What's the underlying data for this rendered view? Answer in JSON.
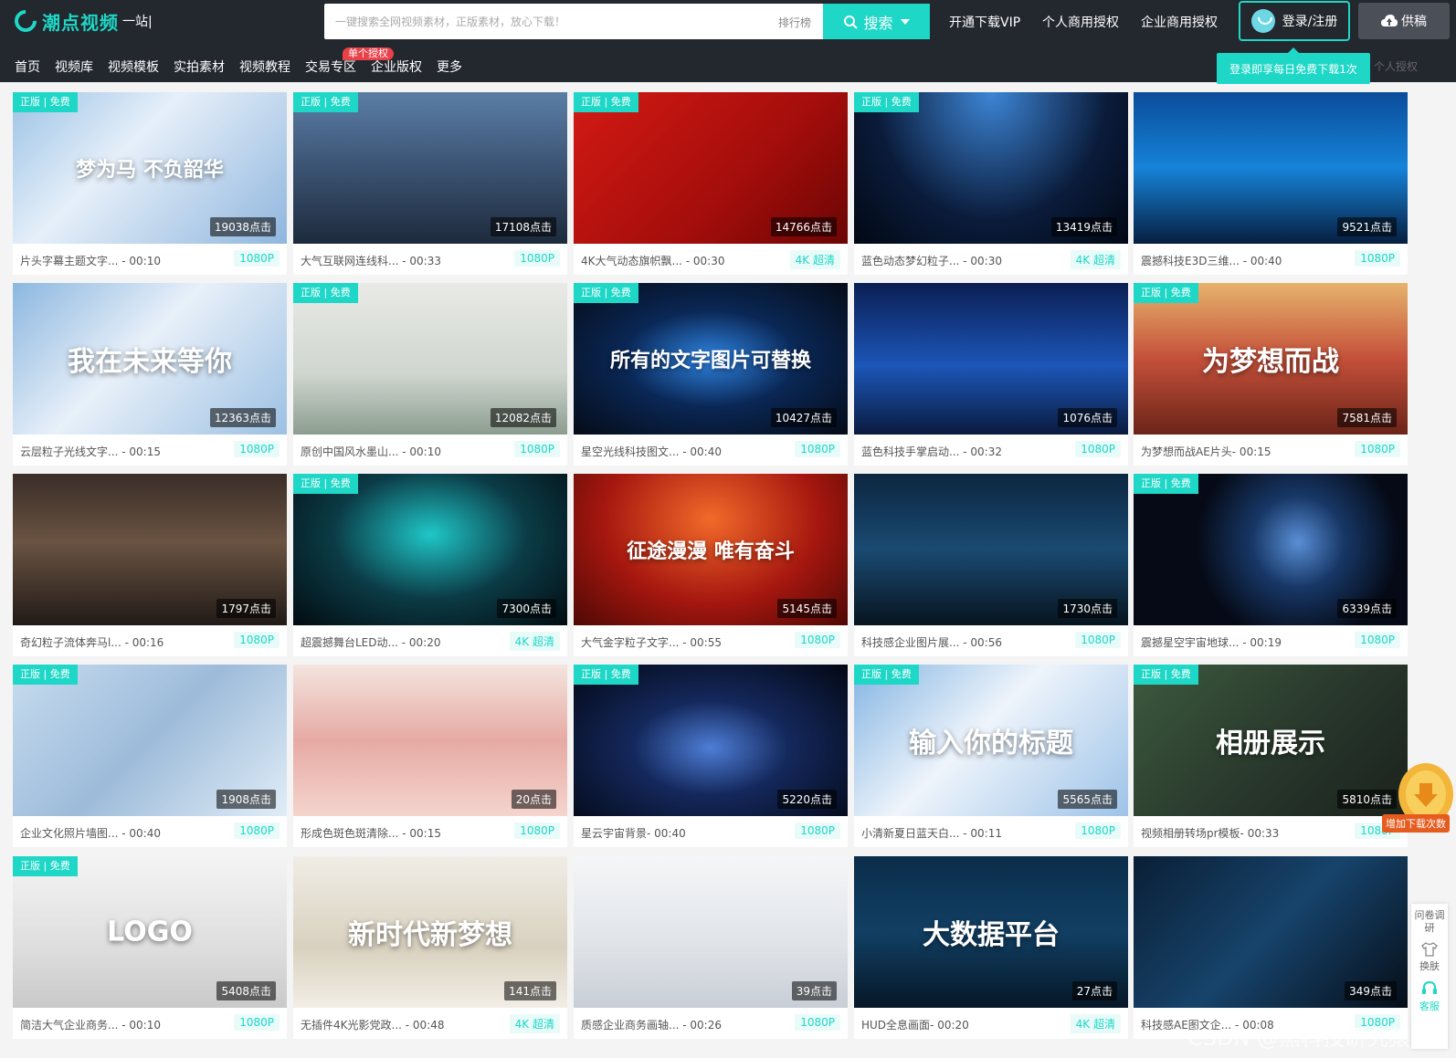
{
  "header": {
    "logo_text": "潮点视频",
    "logo_tag": "一站|",
    "search_placeholder": "一键搜索全网视频素材，正版素材，放心下载！",
    "rank_label": "排行榜",
    "search_button": "搜索",
    "links": [
      "开通下载VIP",
      "个人商用授权",
      "企业商用授权"
    ],
    "login": "登录/注册",
    "contribute": "供稿",
    "tip": "登录即享每日免费下载1次",
    "personal": "个人授权"
  },
  "nav": {
    "items": [
      "首页",
      "视频库",
      "视频模板",
      "实拍素材",
      "视频教程",
      "交易专区",
      "企业版权",
      "更多"
    ],
    "badge": "单个授权"
  },
  "badge_text": "正版 | 免费",
  "cards": [
    {
      "title": "片头字幕主题文字... - 00:10",
      "hits": "19038点击",
      "res": "1080P",
      "badge": true,
      "overlay": "梦为马 不负韶华",
      "bg": "linear-gradient(135deg,#9cc3e6,#e6eff9 40%,#8fb6de)"
    },
    {
      "title": "大气互联网连线科... - 00:33",
      "hits": "17108点击",
      "res": "1080P",
      "badge": true,
      "overlay": "",
      "bg": "linear-gradient(180deg,#5b7ea5,#3b5373 50%,#1d2a3c)"
    },
    {
      "title": "4K大气动态旗帜飘... - 00:30",
      "hits": "14766点击",
      "res": "4K 超清",
      "badge": true,
      "overlay": "",
      "bg": "linear-gradient(135deg,#d41a14,#a30d0b 60%,#6b0605)"
    },
    {
      "title": "蓝色动态梦幻粒子... - 00:30",
      "hits": "13419点击",
      "res": "4K 超清",
      "badge": true,
      "overlay": "",
      "bg": "radial-gradient(ellipse at 50% 0%,#3d86d6,#0a1b3a 60%,#020814)"
    },
    {
      "title": "震撼科技E3D三维... - 00:40",
      "hits": "9521点击",
      "res": "1080P",
      "badge": false,
      "overlay": "",
      "bg": "linear-gradient(180deg,#0a4c9a,#1683d8 50%,#061e3f)"
    },
    {
      "title": "云层粒子光线文字... - 00:15",
      "hits": "12363点击",
      "res": "1080P",
      "badge": false,
      "overlay": "我在未来等你",
      "bg": "linear-gradient(135deg,#8cb7e0,#e8f0f9 45%,#9cc0e3)"
    },
    {
      "title": "原创中国风水墨山... - 00:10",
      "hits": "12082点击",
      "res": "1080P",
      "badge": true,
      "overlay": "",
      "bg": "linear-gradient(180deg,#e9eae5,#cfd6cf 60%,#8c9d8f)"
    },
    {
      "title": "星空光线科技图文... - 00:40",
      "hits": "10427点击",
      "res": "1080P",
      "badge": true,
      "overlay": "所有的文字图片可替换",
      "bg": "radial-gradient(ellipse at 50% 50%,#2f85e3,#0a2755 45%,#050b17)"
    },
    {
      "title": "蓝色科技手掌启动... - 00:32",
      "hits": "1076点击",
      "res": "1080P",
      "badge": false,
      "overlay": "",
      "bg": "linear-gradient(180deg,#0b1f54,#1c56b8 55%,#0a1a3e)"
    },
    {
      "title": "为梦想而战AE片头- 00:15",
      "hits": "7581点击",
      "res": "1080P",
      "badge": true,
      "overlay": "为梦想而战",
      "bg": "linear-gradient(180deg,#e7b36c,#c4503a 50%,#6b2418)"
    },
    {
      "title": "奇幻粒子流体奔马l... - 00:16",
      "hits": "1797点击",
      "res": "1080P",
      "badge": false,
      "overlay": "",
      "bg": "linear-gradient(180deg,#3a2d28,#6a5342 45%,#211a17)"
    },
    {
      "title": "超震撼舞台LED动... - 00:20",
      "hits": "7300点击",
      "res": "4K 超清",
      "badge": true,
      "overlay": "",
      "bg": "radial-gradient(ellipse at 50% 40%,#1fc7c8,#0b3b46 50%,#020b10)"
    },
    {
      "title": "大气金字粒子文字... - 00:55",
      "hits": "5145点击",
      "res": "1080P",
      "badge": false,
      "overlay": "征途漫漫 唯有奋斗",
      "bg": "radial-gradient(ellipse at 50% 30%,#f26a2a,#a6170f 55%,#4e0805)"
    },
    {
      "title": "科技感企业图片展... - 00:56",
      "hits": "1730点击",
      "res": "1080P",
      "badge": false,
      "overlay": "",
      "bg": "linear-gradient(180deg,#0c2640,#1a4a72 50%,#07141f)"
    },
    {
      "title": "震撼星空宇宙地球... - 00:19",
      "hits": "6339点击",
      "res": "1080P",
      "badge": true,
      "overlay": "",
      "bg": "radial-gradient(circle at 60% 45%,#5a8fd6,#173766 25%,#050a16 55%)"
    },
    {
      "title": "企业文化照片墙图... - 00:40",
      "hits": "1908点击",
      "res": "1080P",
      "badge": true,
      "overlay": "",
      "bg": "linear-gradient(135deg,#c7dcef,#9dbbda 50%,#e0edf7)"
    },
    {
      "title": "形成色斑色斑清除... - 00:15",
      "hits": "20点击",
      "res": "1080P",
      "badge": false,
      "overlay": "",
      "bg": "linear-gradient(180deg,#f4e4df,#e6aaa3 50%,#f5d4ce)"
    },
    {
      "title": "星云宇宙背景- 00:40",
      "hits": "5220点击",
      "res": "1080P",
      "badge": true,
      "overlay": "",
      "bg": "radial-gradient(ellipse at 50% 55%,#4e7ed6,#14285c 40%,#030713)"
    },
    {
      "title": "小清新夏日蓝天白... - 00:11",
      "hits": "5565点击",
      "res": "1080P",
      "badge": true,
      "overlay": "输入你的标题",
      "bg": "linear-gradient(135deg,#84b5e3,#eef4fb 45%,#9dc3e8)"
    },
    {
      "title": "视频相册转场pr模板- 00:33",
      "hits": "5810点击",
      "res": "1080P",
      "badge": true,
      "overlay": "相册展示",
      "bg": "linear-gradient(135deg,#3c5a3e,#27352a 60%,#1a221c)"
    },
    {
      "title": "简洁大气企业商务... - 00:10",
      "hits": "5408点击",
      "res": "1080P",
      "badge": true,
      "overlay": "LOGO",
      "bg": "linear-gradient(180deg,#f4f4f4,#dedede 60%,#c9c9c9)"
    },
    {
      "title": "无插件4K光影党政... - 00:48",
      "hits": "141点击",
      "res": "4K 超清",
      "badge": false,
      "overlay": "新时代新梦想",
      "bg": "linear-gradient(180deg,#f0ede6,#d9d1bf 60%,#f2eee6)"
    },
    {
      "title": "质感企业商务画轴... - 00:26",
      "hits": "39点击",
      "res": "1080P",
      "badge": false,
      "overlay": "",
      "bg": "linear-gradient(180deg,#f5f6f8,#dfe3e8 60%,#c8ced6)"
    },
    {
      "title": "HUD全息画面- 00:20",
      "hits": "27点击",
      "res": "4K 超清",
      "badge": false,
      "overlay": "大数据平台",
      "bg": "linear-gradient(180deg,#0b2d4a,#113f63 50%,#061727)"
    },
    {
      "title": "科技感AE图文企... - 00:08",
      "hits": "349点击",
      "res": "1080P",
      "badge": false,
      "overlay": "",
      "bg": "linear-gradient(135deg,#0a1f36,#17436b 50%,#050e18)"
    }
  ],
  "side": {
    "survey": "问卷调研",
    "skin": "换肤",
    "service": "客服"
  },
  "coin_text": "增加下载次数",
  "watermark": "CSDN @黑科技研究猿",
  "colors": {
    "accent": "#1ed7c6",
    "header_bg": "#23272e"
  }
}
